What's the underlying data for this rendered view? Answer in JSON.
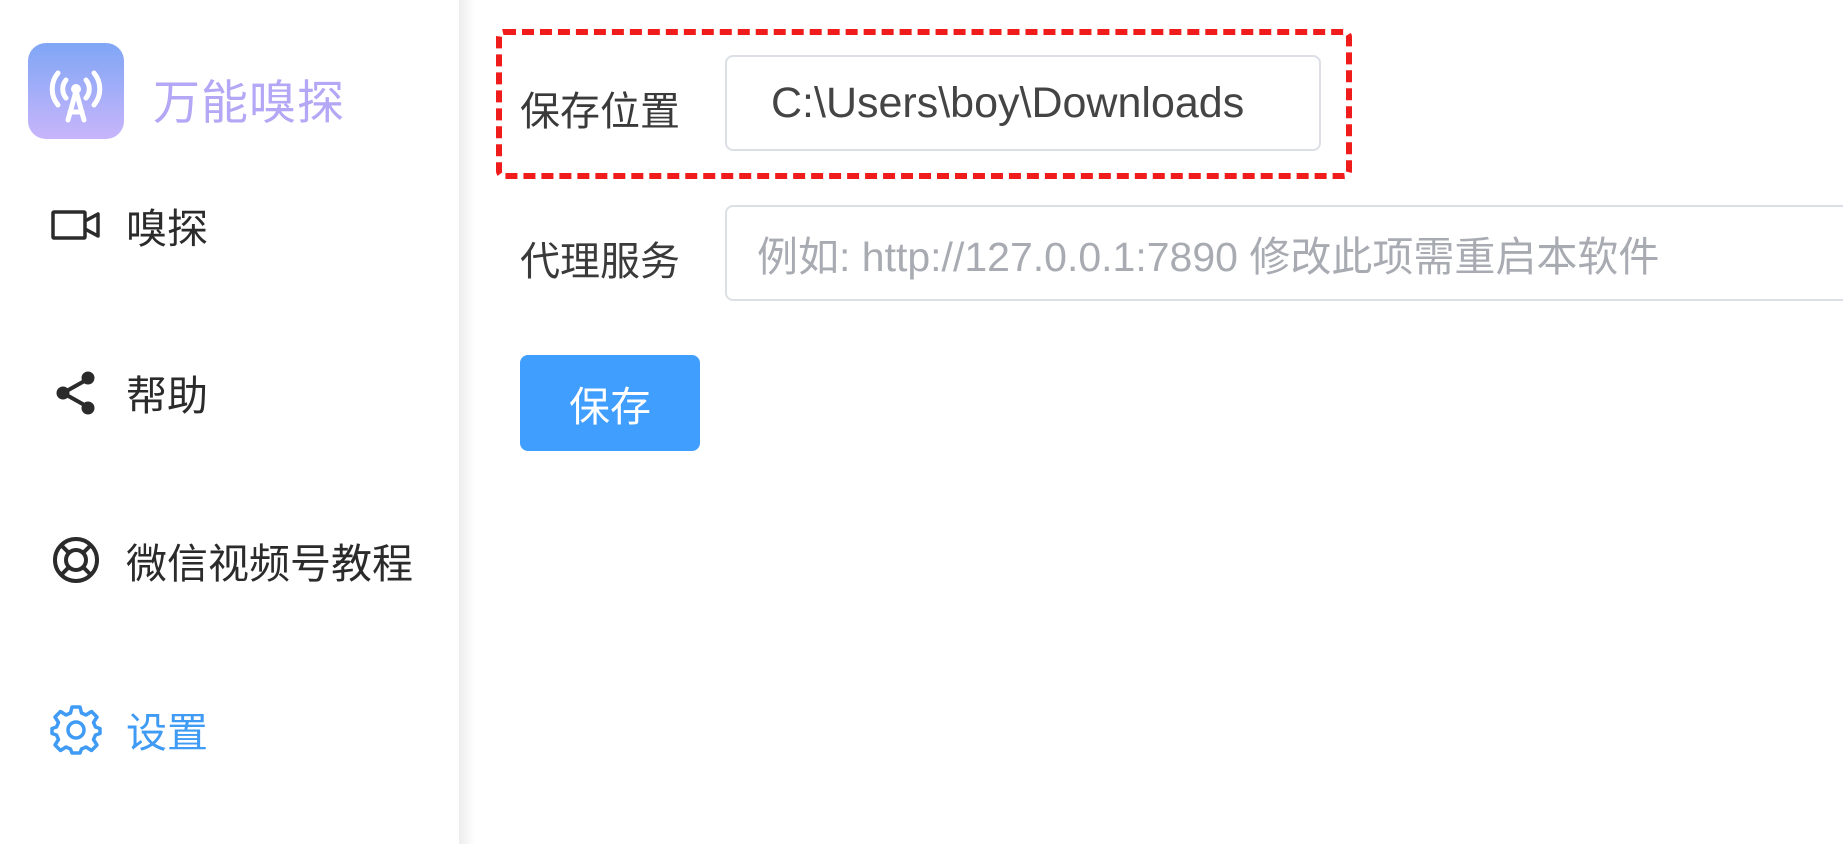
{
  "app": {
    "name": "万能嗅探",
    "logo_icon": "antenna-broadcast-icon"
  },
  "sidebar": {
    "items": [
      {
        "label": "嗅探",
        "icon": "video-camera-icon",
        "active": false
      },
      {
        "label": "帮助",
        "icon": "share-icon",
        "active": false
      },
      {
        "label": "微信视频号教程",
        "icon": "lifebuoy-icon",
        "active": false
      },
      {
        "label": "设置",
        "icon": "gear-icon",
        "active": true
      }
    ]
  },
  "form": {
    "save_location_label": "保存位置",
    "save_location_value": "C:\\Users\\boy\\Downloads",
    "proxy_label": "代理服务",
    "proxy_placeholder": "例如: http://127.0.0.1:7890 修改此项需重启本软件",
    "save_button_label": "保存"
  },
  "colors": {
    "accent": "#409eff",
    "active_nav": "#3f9bf4",
    "highlight_border": "#f01b1b"
  }
}
